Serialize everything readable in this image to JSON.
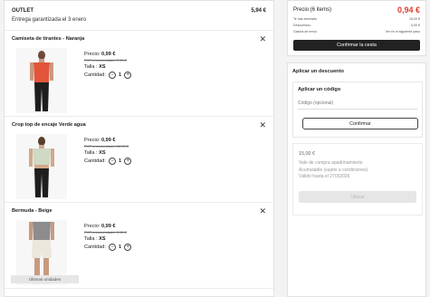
{
  "outlet": {
    "label": "OUTLET",
    "price": "5,94 €",
    "delivery": "Entrega garantizada el 3 enero"
  },
  "items": [
    {
      "title": "Camiseta de tirantes - Naranja",
      "price_label": "Precio: ",
      "price": "0,99 €",
      "pvp": "PVP recomendado: 7,99 €",
      "size_label": "Talla : ",
      "size": "XS",
      "qty_label": "Cantidad:",
      "qty": "1"
    },
    {
      "title": "Crop top de encaje Verde agua",
      "price_label": "Precio: ",
      "price": "0,99 €",
      "pvp": "PVP recomendado: 12,99 €",
      "size_label": "Talla : ",
      "size": "XS",
      "qty_label": "Cantidad:",
      "qty": "1"
    },
    {
      "title": "Bermuda - Beige",
      "price_label": "Precio: ",
      "price": "0,99 €",
      "pvp": "PVP recomendado: 9,99 €",
      "size_label": "Talla : ",
      "size": "XS",
      "qty_label": "Cantidad:",
      "qty": "1",
      "badge": "Últimas unidades"
    }
  ],
  "summary": {
    "price_label": "Precio (6 items)",
    "total": "0,94 €",
    "rows": [
      {
        "label": "Te has ahorrado",
        "value": "16,00 €"
      },
      {
        "label": "Descuentos",
        "value": "- 5,00 €"
      },
      {
        "label": "Gastos de envío",
        "value": "Ver en el siguiente paso"
      }
    ],
    "confirm": "Confirmar la cesta"
  },
  "discount": {
    "title": "Aplicar un descuento",
    "code_title": "Aplicar un código",
    "code_placeholder": "Código (opcional)",
    "code_button": "Confirmar",
    "voucher_amount": "15,00 €",
    "voucher_line1": "Vale de compra apadrinamiento",
    "voucher_line2": "Acumulable (sujeto a condiciones)",
    "voucher_line3": "Válido hasta el 27/3/2026",
    "voucher_button": "Utilizar"
  },
  "colors": {
    "accent_red": "#e03a2f",
    "dark_button": "#222222"
  }
}
